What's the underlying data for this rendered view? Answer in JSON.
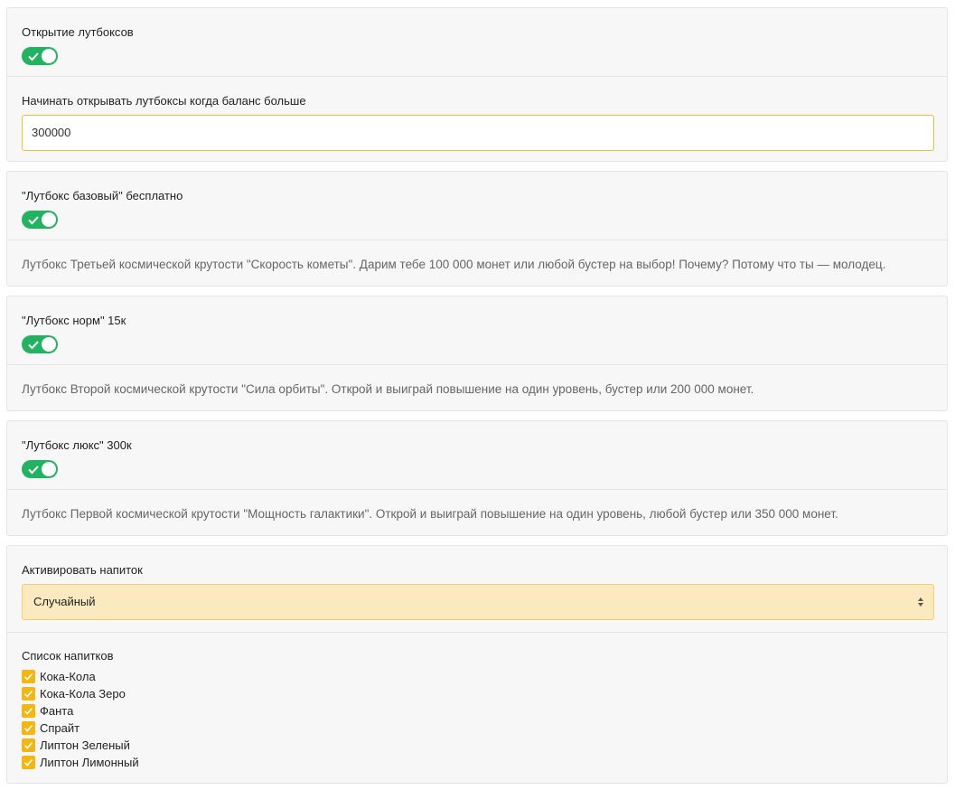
{
  "lootbox_settings": {
    "open_label": "Открытие лутбоксов",
    "open_enabled": true,
    "balance_label": "Начинать открывать лутбоксы когда баланс больше",
    "balance_value": "300000"
  },
  "lootboxes": [
    {
      "title": "\"Лутбокс базовый\" бесплатно",
      "enabled": true,
      "description": "Лутбокс Третьей космической крутости \"Скорость кометы\". Дарим тебе 100 000 монет или любой бустер на выбор! Почему? Потому что ты — молодец."
    },
    {
      "title": "\"Лутбокс норм\" 15к",
      "enabled": true,
      "description": "Лутбокс Второй космической крутости \"Сила орбиты\". Открой и выиграй повышение на один уровень, бустер или 200 000 монет."
    },
    {
      "title": "\"Лутбокс люкс\" 300к",
      "enabled": true,
      "description": "Лутбокс Первой космической крутости \"Мощность галактики\". Открой и выиграй повышение на один уровень, любой бустер или 350 000 монет."
    }
  ],
  "drinks": {
    "activate_label": "Активировать напиток",
    "activate_selected": "Случайный",
    "list_label": "Список напитков",
    "items": [
      {
        "label": "Кока-Кола",
        "checked": true
      },
      {
        "label": "Кока-Кола Зеро",
        "checked": true
      },
      {
        "label": "Фанта",
        "checked": true
      },
      {
        "label": "Спрайт",
        "checked": true
      },
      {
        "label": "Липтон Зеленый",
        "checked": true
      },
      {
        "label": "Липтон Лимонный",
        "checked": true
      }
    ]
  },
  "colors": {
    "toggle_on": "#21b360",
    "checkbox": "#f5b70f",
    "input_border": "#f0c12e",
    "select_bg": "#fbe9bf"
  }
}
